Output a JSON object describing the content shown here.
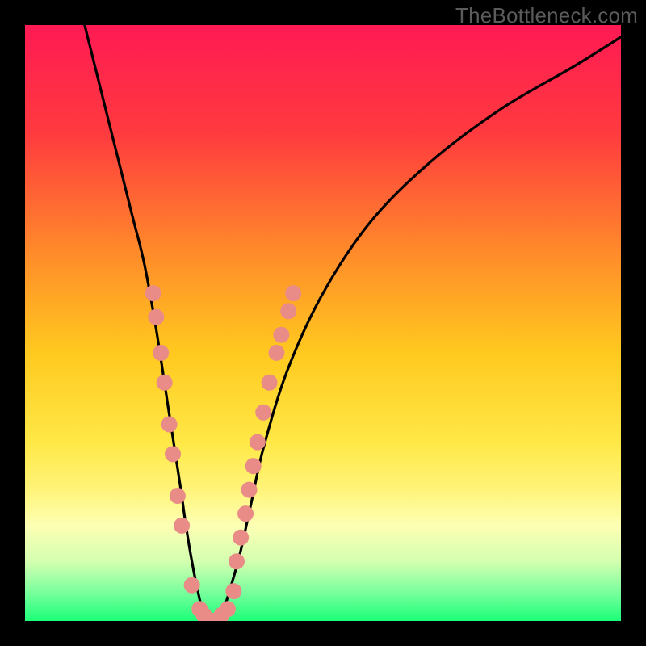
{
  "watermark": {
    "text": "TheBottleneck.com"
  },
  "chart_data": {
    "type": "line",
    "title": "",
    "xlabel": "",
    "ylabel": "",
    "xlim": [
      0,
      100
    ],
    "ylim": [
      0,
      100
    ],
    "gradient_stops": [
      {
        "offset": 0,
        "color": "#ff1a54"
      },
      {
        "offset": 18,
        "color": "#ff3a3f"
      },
      {
        "offset": 38,
        "color": "#ff8a2a"
      },
      {
        "offset": 55,
        "color": "#ffc91f"
      },
      {
        "offset": 70,
        "color": "#ffe846"
      },
      {
        "offset": 78,
        "color": "#fff47a"
      },
      {
        "offset": 84,
        "color": "#fdffb3"
      },
      {
        "offset": 90,
        "color": "#d4ffb0"
      },
      {
        "offset": 95,
        "color": "#7cff9e"
      },
      {
        "offset": 100,
        "color": "#1bff79"
      }
    ],
    "series": [
      {
        "name": "bottleneck-curve",
        "x": [
          10,
          12,
          14,
          16,
          18,
          20,
          22,
          24,
          26,
          27,
          28,
          29,
          30,
          31,
          32,
          33,
          34,
          36,
          38,
          40,
          44,
          50,
          58,
          68,
          80,
          92,
          100
        ],
        "y": [
          100,
          92,
          84,
          76,
          68,
          60,
          49,
          36,
          23,
          16,
          10,
          5,
          1,
          0,
          0,
          1,
          4,
          11,
          20,
          29,
          42,
          55,
          67,
          77,
          86,
          93,
          98
        ]
      }
    ],
    "marker_clusters": [
      {
        "name": "left-descending-cluster",
        "color": "#e98b87",
        "points": [
          {
            "x": 21.5,
            "y": 55
          },
          {
            "x": 22.0,
            "y": 51
          },
          {
            "x": 22.8,
            "y": 45
          },
          {
            "x": 23.4,
            "y": 40
          },
          {
            "x": 24.2,
            "y": 33
          },
          {
            "x": 24.8,
            "y": 28
          },
          {
            "x": 25.6,
            "y": 21
          },
          {
            "x": 26.3,
            "y": 16
          }
        ]
      },
      {
        "name": "valley-cluster",
        "color": "#e98b87",
        "points": [
          {
            "x": 28.0,
            "y": 6
          },
          {
            "x": 29.3,
            "y": 2
          },
          {
            "x": 30.0,
            "y": 1
          },
          {
            "x": 30.8,
            "y": 0
          },
          {
            "x": 31.5,
            "y": 0
          },
          {
            "x": 32.3,
            "y": 0
          },
          {
            "x": 33.0,
            "y": 1
          },
          {
            "x": 34.0,
            "y": 2
          },
          {
            "x": 35.0,
            "y": 5
          }
        ]
      },
      {
        "name": "right-ascending-cluster",
        "color": "#e98b87",
        "points": [
          {
            "x": 35.5,
            "y": 10
          },
          {
            "x": 36.2,
            "y": 14
          },
          {
            "x": 37.0,
            "y": 18
          },
          {
            "x": 37.6,
            "y": 22
          },
          {
            "x": 38.3,
            "y": 26
          },
          {
            "x": 39.0,
            "y": 30
          },
          {
            "x": 40.0,
            "y": 35
          },
          {
            "x": 41.0,
            "y": 40
          },
          {
            "x": 42.2,
            "y": 45
          },
          {
            "x": 43.0,
            "y": 48
          },
          {
            "x": 44.2,
            "y": 52
          },
          {
            "x": 45.0,
            "y": 55
          }
        ]
      }
    ]
  }
}
